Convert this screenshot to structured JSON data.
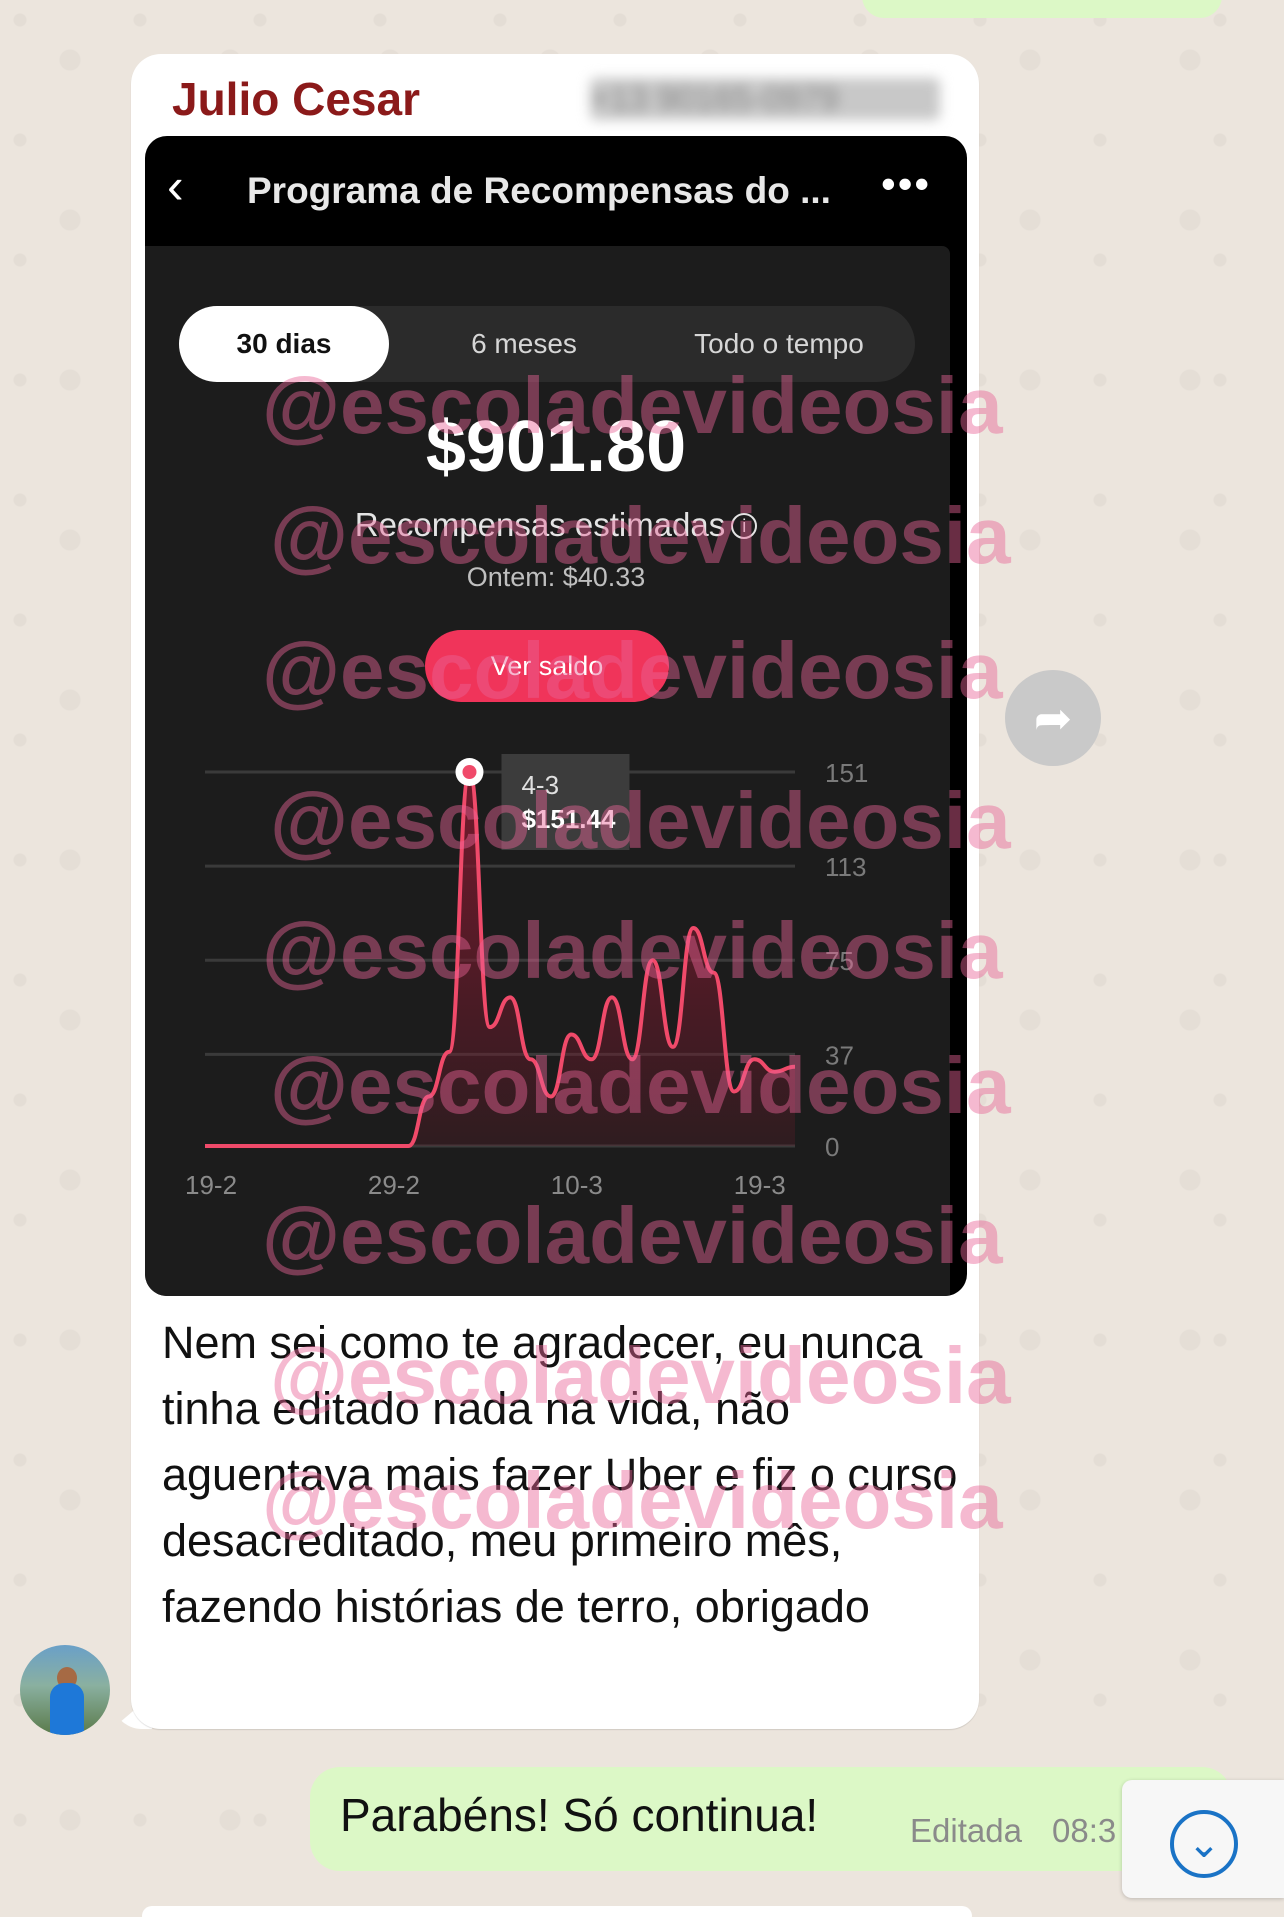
{
  "incoming_message": {
    "sender_name": "Julio Cesar",
    "sender_phone": "+13 90165-0979",
    "text": "Nem sei como te agradecer, eu nunca tinha editado nada na vida, não aguentava mais fazer Uber e fiz o curso desacreditado, meu primeiro mês, fazendo histórias de terro, obrigado"
  },
  "screenshot": {
    "header_title": "Programa de Recompensas do ...",
    "back_icon": "chevron-left-icon",
    "more_icon": "more-horizontal-icon",
    "tabs": [
      {
        "label": "30 dias",
        "active": true
      },
      {
        "label": "6 meses",
        "active": false
      },
      {
        "label": "Todo o tempo",
        "active": false
      }
    ],
    "amount": "$901.80",
    "amount_label": "Recompensas estimadas",
    "yesterday": "Ontem: $40.33",
    "button_label": "Ver saldo",
    "tooltip_date": "4-3",
    "tooltip_value": "$151.44",
    "watermark": "@escoladevideosia"
  },
  "chart_data": {
    "type": "area",
    "x_ticks": [
      "19-2",
      "29-2",
      "10-3",
      "19-3"
    ],
    "y_ticks": [
      "151",
      "113",
      "75",
      "37",
      "0"
    ],
    "ylim": [
      0,
      151
    ],
    "x": [
      1,
      2,
      3,
      4,
      5,
      6,
      7,
      8,
      9,
      10,
      11,
      12,
      13,
      14,
      15,
      16,
      17,
      18,
      19,
      20,
      21,
      22,
      23,
      24,
      25,
      26,
      27,
      28,
      29,
      30
    ],
    "values": [
      0,
      0,
      0,
      0,
      0,
      0,
      0,
      0,
      0,
      0,
      0,
      20,
      38,
      151,
      48,
      60,
      35,
      20,
      45,
      35,
      60,
      35,
      75,
      40,
      88,
      70,
      22,
      35,
      30,
      32
    ],
    "highlight": {
      "x": 14,
      "label": "4-3",
      "value": 151.44
    },
    "colors": {
      "line": "#f04a6a",
      "fill": "#7a1a2e",
      "grid": "#3a3a3a"
    }
  },
  "outgoing_message": {
    "text": "Parabéns! Só continua!",
    "edited_label": "Editada",
    "time": "08:3"
  },
  "icons": {
    "forward": "forward-arrow-icon",
    "scroll_down": "chevron-down-circle-icon",
    "avatar": "contact-avatar"
  },
  "colors": {
    "sender": "#8b1a1a",
    "outgoing_bubble": "#dcf8c6",
    "button": "#f0345a"
  }
}
